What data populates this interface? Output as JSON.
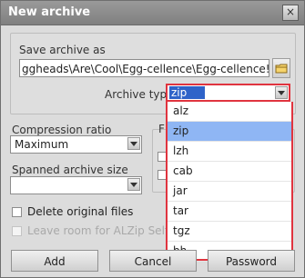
{
  "window": {
    "title": "New archive",
    "close_label": "×"
  },
  "save_archive": {
    "label": "Save archive as",
    "path": "ggheads\\Are\\Cool\\Egg-cellence\\Egg-cellence!.zip"
  },
  "archive_type": {
    "label": "Archive type",
    "selected": "zip",
    "options": [
      "alz",
      "zip",
      "lzh",
      "cab",
      "jar",
      "tar",
      "tgz",
      "bh"
    ]
  },
  "compression": {
    "label": "Compression ratio",
    "value": "Maximum"
  },
  "spanned": {
    "label": "Spanned archive size",
    "value": ""
  },
  "right_group": {
    "label_partial": "F"
  },
  "checkboxes": {
    "delete_original": "Delete original files",
    "leave_room": "Leave room for ALZip Self-E"
  },
  "buttons": {
    "add": "Add",
    "cancel": "Cancel",
    "password": "Password"
  },
  "colors": {
    "highlight": "#e0343f",
    "selected_value": "#2f63c9",
    "selected_option": "#8fb6f4"
  }
}
